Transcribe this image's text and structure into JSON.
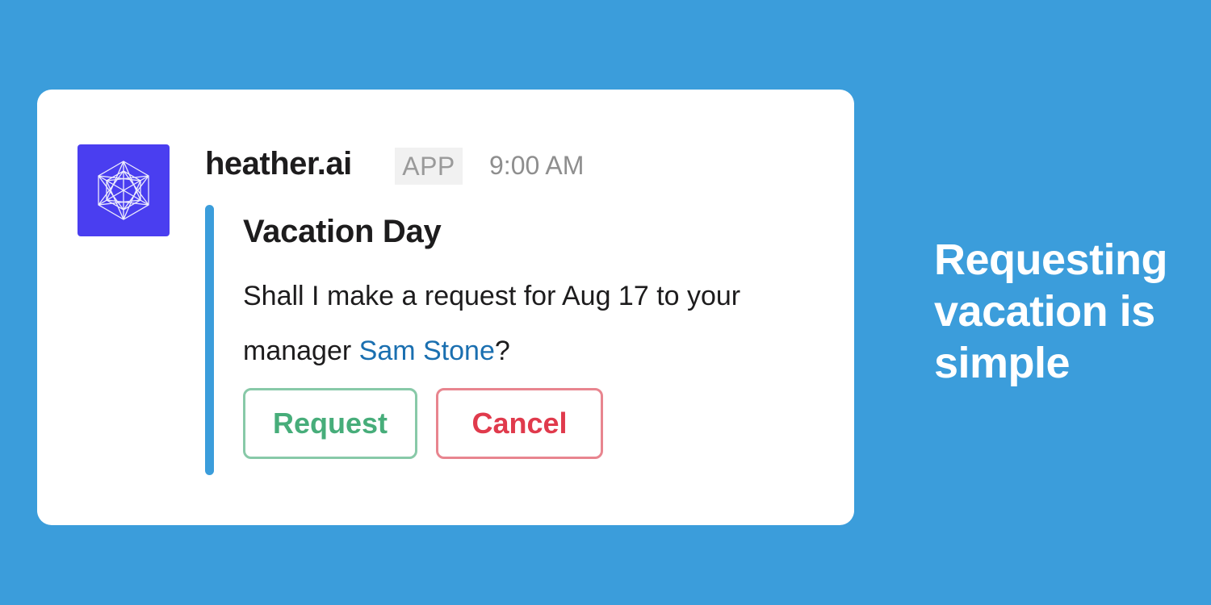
{
  "message": {
    "sender": "heather.ai",
    "badge": "APP",
    "timestamp": "9:00 AM",
    "avatar_icon": "geometric-hexagon-logo-icon",
    "colors": {
      "avatar_bg": "#4a3ef0",
      "accent_bar": "#3b9ddb",
      "request_green": "#47ad7a",
      "cancel_red": "#e03a4c",
      "mention_blue": "#1a6fb0"
    }
  },
  "attachment": {
    "title": "Vacation Day",
    "text_before": "Shall I make a request for Aug 17 to your manager ",
    "mention": "Sam Stone",
    "text_after": "?"
  },
  "actions": {
    "request_label": "Request",
    "cancel_label": "Cancel"
  },
  "tagline": "Requesting vacation is simple",
  "page_background": "#3b9ddb"
}
